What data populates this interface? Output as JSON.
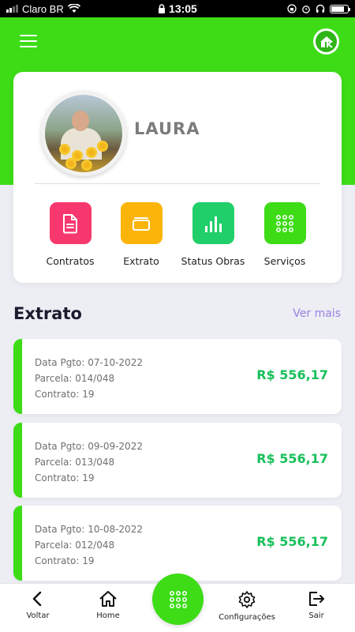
{
  "status_bar": {
    "carrier": "Claro BR",
    "time": "13:05"
  },
  "colors": {
    "brand_green": "#3ddc17",
    "amount_green": "#17c05a",
    "link_purple": "#9b7fe0",
    "contracts_pink": "#f7386e",
    "extrato_amber": "#fbb40a",
    "status_green": "#20cf6a"
  },
  "header": {
    "menu_icon": "hamburger-menu-icon",
    "logo_icon": "brand-logo-icon"
  },
  "profile": {
    "name": "LAURA"
  },
  "quick_actions": [
    {
      "label": "Contratos",
      "icon": "document-icon"
    },
    {
      "label": "Extrato",
      "icon": "wallet-icon"
    },
    {
      "label": "Status Obras",
      "icon": "bar-chart-icon"
    },
    {
      "label": "Serviços",
      "icon": "grid-icon"
    }
  ],
  "extrato": {
    "title": "Extrato",
    "see_more": "Ver mais",
    "entries": [
      {
        "date": "Data Pgto: 07-10-2022",
        "parcela": "Parcela: 014/048",
        "contrato": "Contrato: 19",
        "amount": "R$ 556,17"
      },
      {
        "date": "Data Pgto: 09-09-2022",
        "parcela": "Parcela: 013/048",
        "contrato": "Contrato: 19",
        "amount": "R$ 556,17"
      },
      {
        "date": "Data Pgto: 10-08-2022",
        "parcela": "Parcela: 012/048",
        "contrato": "Contrato: 19",
        "amount": "R$ 556,17"
      }
    ]
  },
  "bottom_nav": {
    "back": "Voltar",
    "home": "Home",
    "settings": "Configurações",
    "exit": "Sair"
  }
}
